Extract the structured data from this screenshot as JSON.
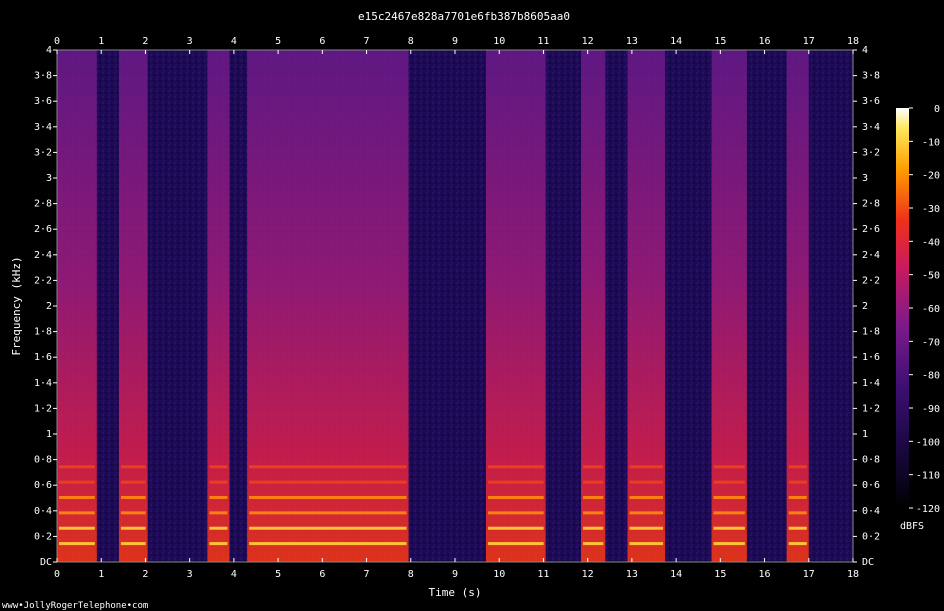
{
  "chart_data": {
    "type": "heatmap",
    "title": "e15c2467e828a7701e6fb387b8605aa0",
    "xlabel": "Time (s)",
    "ylabel": "Frequency (kHz)",
    "xlim": [
      0,
      18
    ],
    "ylim": [
      0,
      4
    ],
    "x_ticks": [
      "0",
      "1",
      "2",
      "3",
      "4",
      "5",
      "6",
      "7",
      "8",
      "9",
      "10",
      "11",
      "12",
      "13",
      "14",
      "15",
      "16",
      "17",
      "18"
    ],
    "y_ticks": [
      "DC",
      "0·2",
      "0·4",
      "0·6",
      "0·8",
      "1",
      "1·2",
      "1·4",
      "1·6",
      "1·8",
      "2",
      "2·2",
      "2·4",
      "2·6",
      "2·8",
      "3",
      "3·2",
      "3·4",
      "3·6",
      "3·8",
      "4"
    ],
    "colorbar": {
      "label": "dBFS",
      "ticks": [
        "0",
        "-10",
        "-20",
        "-30",
        "-40",
        "-50",
        "-60",
        "-70",
        "-80",
        "-90",
        "-100",
        "-110",
        "-120"
      ],
      "range": [
        -120,
        0
      ]
    },
    "segments": [
      {
        "t0": 0.0,
        "t1": 0.9,
        "level": -55
      },
      {
        "t0": 1.4,
        "t1": 2.05,
        "level": -50
      },
      {
        "t0": 3.4,
        "t1": 3.9,
        "level": -55
      },
      {
        "t0": 4.3,
        "t1": 7.95,
        "level": -45
      },
      {
        "t0": 9.7,
        "t1": 11.05,
        "level": -60
      },
      {
        "t0": 11.85,
        "t1": 12.4,
        "level": -50
      },
      {
        "t0": 12.9,
        "t1": 13.75,
        "level": -50
      },
      {
        "t0": 14.8,
        "t1": 15.6,
        "level": -50
      },
      {
        "t0": 16.5,
        "t1": 17.0,
        "level": -55
      }
    ]
  },
  "footer": {
    "credit": "www•JollyRogerTelephone•com"
  }
}
